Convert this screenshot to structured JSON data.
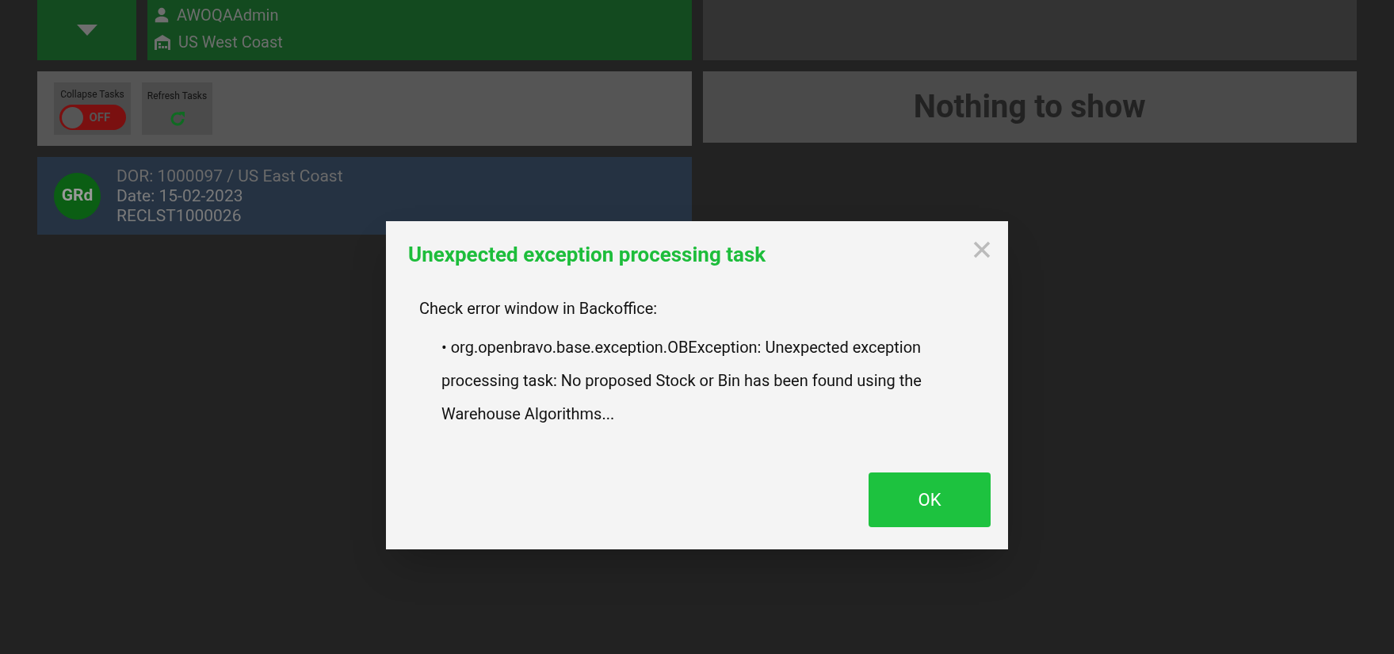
{
  "header": {
    "user": "AWOQAAdmin",
    "warehouse": "US West Coast"
  },
  "toolbar": {
    "collapse_toggle": {
      "label": "Collapse Tasks",
      "on": false,
      "state_text": "OFF"
    },
    "refresh": {
      "label": "Refresh Tasks"
    }
  },
  "tasks": [
    {
      "avatar": "GRd",
      "title": "DOR: 1000097 / US East Coast",
      "date": "Date: 15-02-2023",
      "reference": "RECLST1000026"
    }
  ],
  "right_panel": {
    "empty_message": "Nothing to show"
  },
  "dialog": {
    "title": "Unexpected exception processing task",
    "intro": "Check error window in Backoffice:",
    "errors": [
      "• org.openbravo.base.exception.OBException: Unexpected exception processing task: No proposed Stock or Bin has been found using the Warehouse Algorithms..."
    ],
    "button": "OK"
  }
}
